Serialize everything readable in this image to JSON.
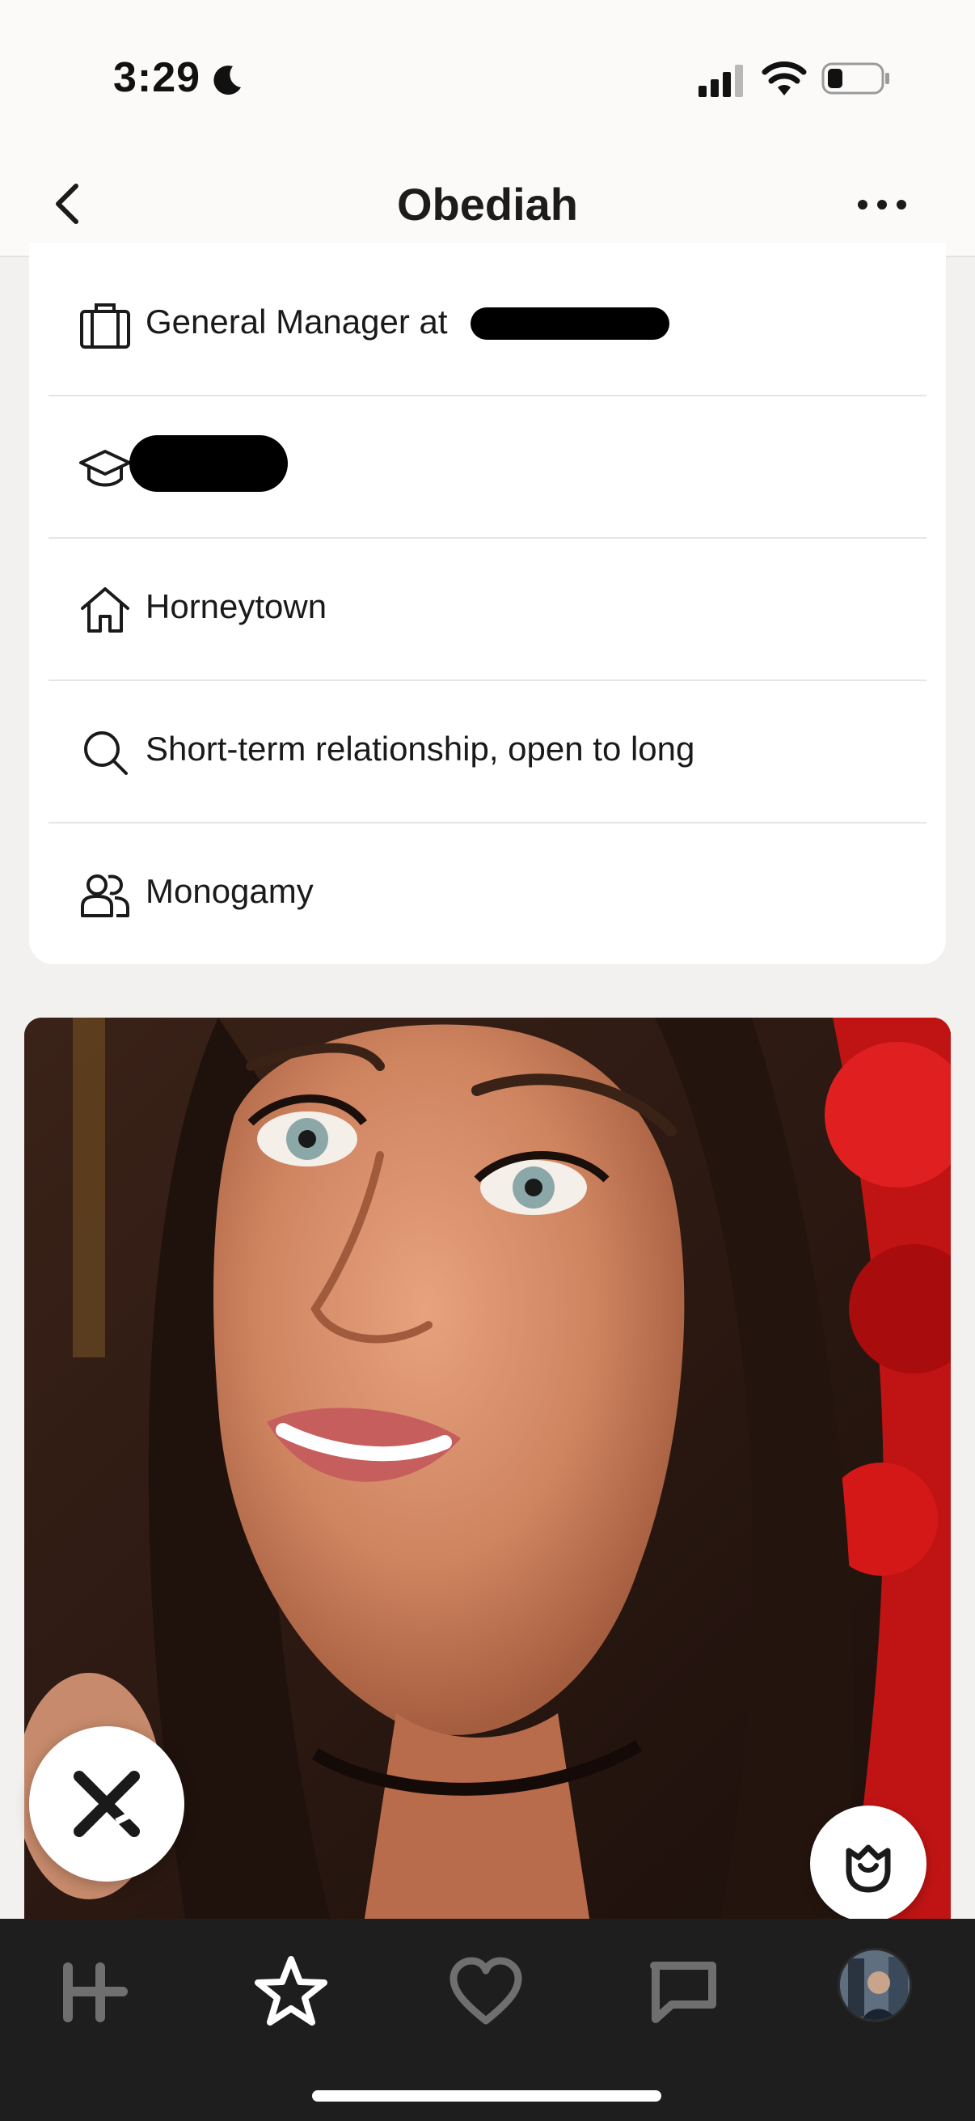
{
  "status_bar": {
    "time": "3:29",
    "icons": [
      "moon-icon",
      "signal-icon",
      "wifi-icon",
      "battery-icon"
    ]
  },
  "nav": {
    "title": "Obediah",
    "back_icon": "chevron-left-icon",
    "more_icon": "ellipsis-icon"
  },
  "details": [
    {
      "icon": "briefcase-icon",
      "label": "General Manager at"
    },
    {
      "icon": "graduation-cap-icon",
      "label": ""
    },
    {
      "icon": "house-icon",
      "label": "Horneytown"
    },
    {
      "icon": "search-icon",
      "label": "Short-term relationship, open to long"
    },
    {
      "icon": "people-icon",
      "label": "Monogamy"
    }
  ],
  "actions": {
    "pass_icon": "x-icon",
    "rose_icon": "rose-icon"
  },
  "tab_bar": {
    "tabs": [
      "logo-tab-icon",
      "star-icon",
      "heart-icon",
      "chat-icon",
      "profile-avatar"
    ],
    "active": "star-icon"
  },
  "colors": {
    "background": "#f2f1f0",
    "card": "#ffffff",
    "tab_bar": "#1e1e1e",
    "text": "#1a1a1a"
  }
}
